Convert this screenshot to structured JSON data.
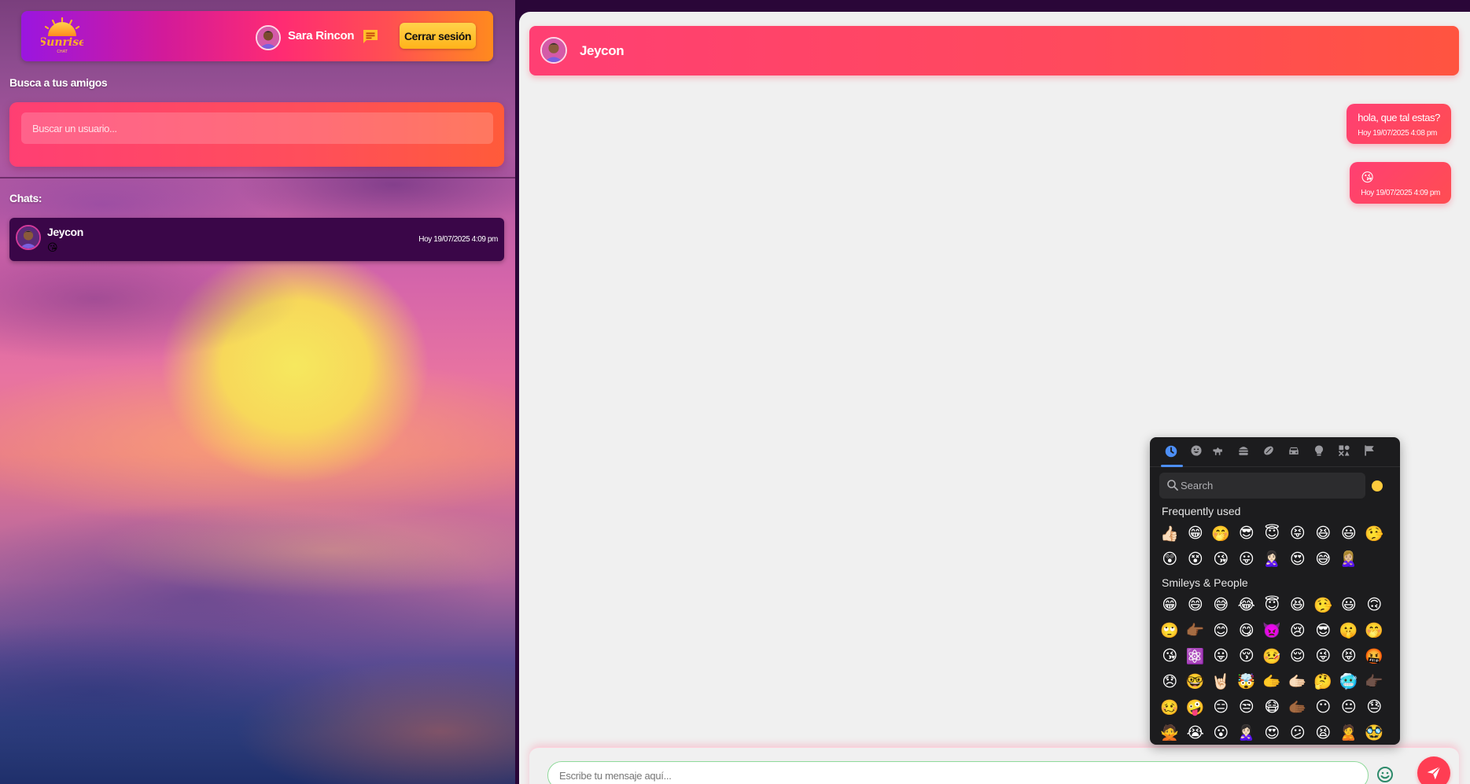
{
  "app": {
    "logo_text": "Sunrise",
    "logo_subtext": "CHAT",
    "user_name": "Sara Rincon",
    "logout_label": "Cerrar sesión"
  },
  "sidebar": {
    "search_label": "Busca a tus amigos",
    "search_placeholder": "Buscar un usuario...",
    "chats_label": "Chats:",
    "chats": [
      {
        "name": "Jeycon",
        "last_message": "😘",
        "time": "Hoy 19/07/2025 4:09 pm"
      }
    ]
  },
  "conversation": {
    "contact_name": "Jeycon",
    "messages": [
      {
        "text": "hola, que tal estas?",
        "time": "Hoy 19/07/2025 4:08 pm"
      },
      {
        "text": "😘",
        "time": "Hoy 19/07/2025 4:09 pm"
      }
    ],
    "composer_placeholder": "Escribe tu mensaje aquí..."
  },
  "emoji_picker": {
    "categories": [
      "recent-icon",
      "smileys-icon",
      "animals-icon",
      "food-icon",
      "activities-icon",
      "travel-icon",
      "objects-icon",
      "symbols-icon",
      "flags-icon"
    ],
    "search_placeholder": "Search",
    "frequently_used_title": "Frequently used",
    "frequently_used": [
      "👍🏻",
      "😁",
      "🤭",
      "😎",
      "😇",
      "😝",
      "😆",
      "😃",
      "🤥",
      "😲",
      "😵",
      "😘",
      "😛",
      "🙎🏻‍♀️",
      "😍",
      "😅",
      "🙎🏼‍♀️"
    ],
    "smileys_title": "Smileys & People",
    "smileys": [
      "😁",
      "😄",
      "😅",
      "😂",
      "😇",
      "😆",
      "🤥",
      "😃",
      "🙃",
      "🙄",
      "👉🏾",
      "😊",
      "😋",
      "👿",
      "😢",
      "😎",
      "🤫",
      "🤭",
      "😘",
      "⚛️",
      "😛",
      "😚",
      "🤒",
      "😌",
      "😜",
      "😝",
      "🤬",
      "😞",
      "🤓",
      "🤘🏻",
      "🤯",
      "🫱",
      "🫱🏻",
      "🤔",
      "🥶",
      "👉🏿",
      "🥴",
      "🤪",
      "😑",
      "😒",
      "😷",
      "🫱🏾",
      "😶",
      "😐",
      "😓",
      "🙅",
      "😭",
      "😮",
      "🙎🏻‍♀️",
      "😍",
      "😕",
      "😫",
      "🙎",
      "🥸"
    ]
  },
  "colors": {
    "accent": "#ff3f73",
    "logout": "#ffc02a",
    "picker_bg": "#1c1c1e",
    "picker_active": "#4d8ff7",
    "sidebar_dark": "#3a0648"
  }
}
